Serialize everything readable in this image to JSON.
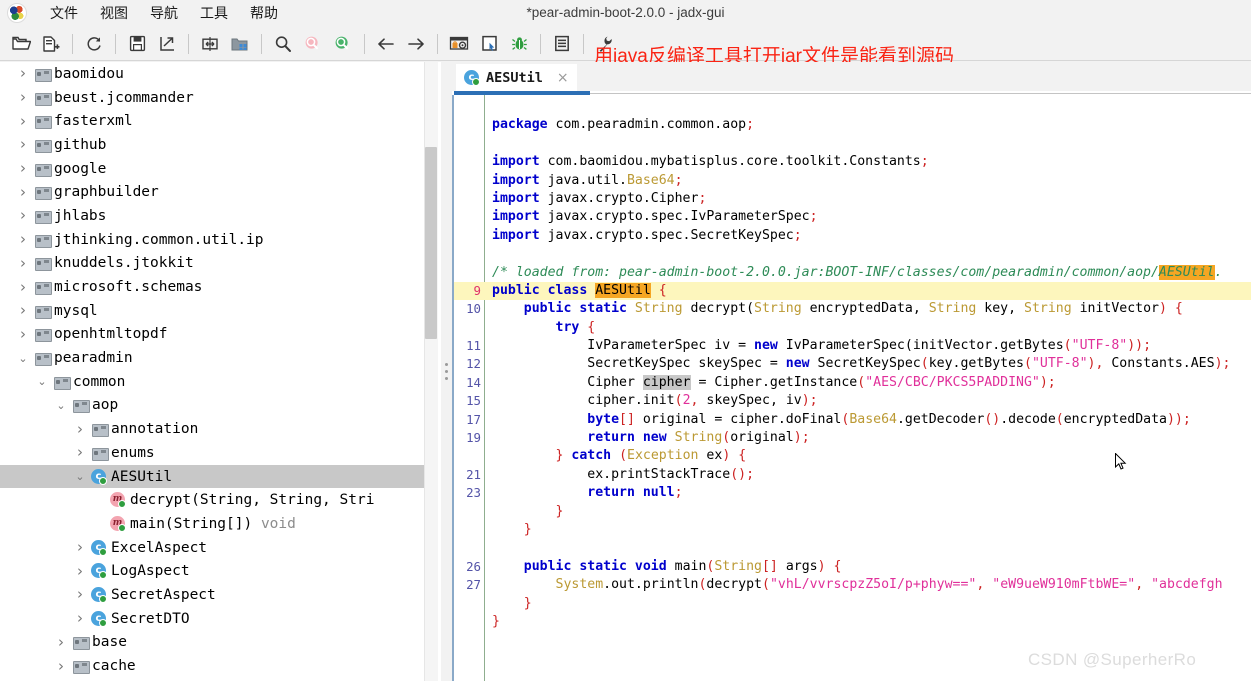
{
  "window": {
    "title": "*pear-admin-boot-2.0.0 - jadx-gui"
  },
  "annotation": {
    "text": "用java反编译工具打开jar文件是能看到源码",
    "color": "#fa2414"
  },
  "watermark": "CSDN @SuperherRo",
  "menubar": {
    "logo": "jadx-logo-icon",
    "items": [
      {
        "label": "文件"
      },
      {
        "label": "视图"
      },
      {
        "label": "导航"
      },
      {
        "label": "工具"
      },
      {
        "label": "帮助"
      }
    ]
  },
  "toolbar": {
    "buttons": [
      {
        "name": "open-file-icon",
        "title": "打开文件"
      },
      {
        "name": "add-files-icon",
        "title": "添加文件"
      },
      {
        "sep": true
      },
      {
        "name": "reload-icon",
        "title": "重新加载"
      },
      {
        "sep": true
      },
      {
        "name": "save-all-icon",
        "title": "保存全部"
      },
      {
        "name": "export-gradle-icon",
        "title": "导出"
      },
      {
        "sep": true
      },
      {
        "name": "sync-icon",
        "title": "同步"
      },
      {
        "name": "flatten-packages-icon",
        "title": "扁平化包"
      },
      {
        "sep": true
      },
      {
        "name": "search-icon",
        "title": "搜索文本"
      },
      {
        "name": "search-class-icon",
        "title": "搜索类"
      },
      {
        "name": "search-comment-icon",
        "title": "搜索注释"
      },
      {
        "sep": true
      },
      {
        "name": "back-arrow-icon",
        "title": "后退"
      },
      {
        "name": "forward-arrow-icon",
        "title": "前进"
      },
      {
        "sep": true
      },
      {
        "name": "deobfuscation-icon",
        "title": "反混淆"
      },
      {
        "name": "quark-icon",
        "title": "Quark 引擎"
      },
      {
        "name": "bug-icon",
        "title": "调试"
      },
      {
        "sep": true
      },
      {
        "name": "log-viewer-icon",
        "title": "日志"
      },
      {
        "sep": true
      },
      {
        "name": "preferences-wrench-icon",
        "title": "设置"
      }
    ]
  },
  "tree": {
    "rows": [
      {
        "indent": 1,
        "twisty": "collapsed",
        "icon": "folder-icon",
        "label": "baomidou"
      },
      {
        "indent": 1,
        "twisty": "collapsed",
        "icon": "folder-icon",
        "label": "beust.jcommander"
      },
      {
        "indent": 1,
        "twisty": "collapsed",
        "icon": "folder-icon",
        "label": "fasterxml"
      },
      {
        "indent": 1,
        "twisty": "collapsed",
        "icon": "folder-icon",
        "label": "github"
      },
      {
        "indent": 1,
        "twisty": "collapsed",
        "icon": "folder-icon",
        "label": "google"
      },
      {
        "indent": 1,
        "twisty": "collapsed",
        "icon": "folder-icon",
        "label": "graphbuilder"
      },
      {
        "indent": 1,
        "twisty": "collapsed",
        "icon": "folder-icon",
        "label": "jhlabs"
      },
      {
        "indent": 1,
        "twisty": "collapsed",
        "icon": "folder-icon",
        "label": "jthinking.common.util.ip"
      },
      {
        "indent": 1,
        "twisty": "collapsed",
        "icon": "folder-icon",
        "label": "knuddels.jtokkit"
      },
      {
        "indent": 1,
        "twisty": "collapsed",
        "icon": "folder-icon",
        "label": "microsoft.schemas"
      },
      {
        "indent": 1,
        "twisty": "collapsed",
        "icon": "folder-icon",
        "label": "mysql"
      },
      {
        "indent": 1,
        "twisty": "collapsed",
        "icon": "folder-icon",
        "label": "openhtmltopdf"
      },
      {
        "indent": 1,
        "twisty": "expanded",
        "icon": "folder-icon",
        "label": "pearadmin"
      },
      {
        "indent": 2,
        "twisty": "expanded",
        "icon": "folder-icon",
        "label": "common"
      },
      {
        "indent": 3,
        "twisty": "expanded",
        "icon": "folder-icon",
        "label": "aop"
      },
      {
        "indent": 4,
        "twisty": "collapsed",
        "icon": "folder-icon",
        "label": "annotation"
      },
      {
        "indent": 4,
        "twisty": "collapsed",
        "icon": "folder-icon",
        "label": "enums"
      },
      {
        "indent": 4,
        "twisty": "expanded",
        "icon": "class-icon",
        "label": "AESUtil",
        "selected": true
      },
      {
        "indent": 5,
        "twisty": "none",
        "icon": "method-icon",
        "label": "decrypt(String, String, Stri"
      },
      {
        "indent": 5,
        "twisty": "none",
        "icon": "method-icon",
        "label": "main(String[])",
        "label_dim": " void"
      },
      {
        "indent": 4,
        "twisty": "collapsed",
        "icon": "class-icon",
        "label": "ExcelAspect"
      },
      {
        "indent": 4,
        "twisty": "collapsed",
        "icon": "class-icon",
        "label": "LogAspect"
      },
      {
        "indent": 4,
        "twisty": "collapsed",
        "icon": "class-icon",
        "label": "SecretAspect"
      },
      {
        "indent": 4,
        "twisty": "collapsed",
        "icon": "class-icon",
        "label": "SecretDTO"
      },
      {
        "indent": 3,
        "twisty": "collapsed",
        "icon": "folder-icon",
        "label": "base"
      },
      {
        "indent": 3,
        "twisty": "collapsed",
        "icon": "folder-icon",
        "label": "cache"
      }
    ]
  },
  "editor": {
    "tab": {
      "label": "AESUtil",
      "icon": "class-icon",
      "close": "×"
    },
    "code": [
      {
        "num": "",
        "tokens": []
      },
      {
        "num": "",
        "tokens": [
          {
            "t": "kw",
            "v": "package"
          },
          {
            "t": "plain",
            "v": " com.pearadmin.common.aop"
          },
          {
            "t": "pun",
            "v": ";"
          }
        ]
      },
      {
        "num": "",
        "tokens": []
      },
      {
        "num": "",
        "tokens": [
          {
            "t": "kw",
            "v": "import"
          },
          {
            "t": "plain",
            "v": " com.baomidou.mybatisplus.core.toolkit.Constants"
          },
          {
            "t": "pun",
            "v": ";"
          }
        ]
      },
      {
        "num": "",
        "tokens": [
          {
            "t": "kw",
            "v": "import"
          },
          {
            "t": "plain",
            "v": " java.util."
          },
          {
            "t": "typ",
            "v": "Base64"
          },
          {
            "t": "pun",
            "v": ";"
          }
        ]
      },
      {
        "num": "",
        "tokens": [
          {
            "t": "kw",
            "v": "import"
          },
          {
            "t": "plain",
            "v": " javax.crypto.Cipher"
          },
          {
            "t": "pun",
            "v": ";"
          }
        ]
      },
      {
        "num": "",
        "tokens": [
          {
            "t": "kw",
            "v": "import"
          },
          {
            "t": "plain",
            "v": " javax.crypto.spec.IvParameterSpec"
          },
          {
            "t": "pun",
            "v": ";"
          }
        ]
      },
      {
        "num": "",
        "tokens": [
          {
            "t": "kw",
            "v": "import"
          },
          {
            "t": "plain",
            "v": " javax.crypto.spec.SecretKeySpec"
          },
          {
            "t": "pun",
            "v": ";"
          }
        ]
      },
      {
        "num": "",
        "tokens": []
      },
      {
        "num": "",
        "tokens": [
          {
            "t": "cmt",
            "v": "/* loaded from: pear-admin-boot-2.0.0.jar:BOOT-INF/classes/com/pearadmin/common/aop/"
          },
          {
            "t": "cmt mark",
            "v": "AESUtil"
          },
          {
            "t": "cmt",
            "v": "."
          }
        ]
      },
      {
        "num": "9",
        "hl": true,
        "cur": true,
        "tokens": [
          {
            "t": "kw",
            "v": "public class "
          },
          {
            "t": "plain mark",
            "v": "AESUtil"
          },
          {
            "t": "pun",
            "v": " {"
          }
        ]
      },
      {
        "num": "10",
        "tokens": [
          {
            "t": "plain",
            "v": "    "
          },
          {
            "t": "kw",
            "v": "public static "
          },
          {
            "t": "typ",
            "v": "String"
          },
          {
            "t": "plain",
            "v": " decrypt("
          },
          {
            "t": "typ",
            "v": "String"
          },
          {
            "t": "plain",
            "v": " encryptedData, "
          },
          {
            "t": "typ",
            "v": "String"
          },
          {
            "t": "plain",
            "v": " key, "
          },
          {
            "t": "typ",
            "v": "String"
          },
          {
            "t": "plain",
            "v": " initVector"
          },
          {
            "t": "pun",
            "v": ") {"
          }
        ]
      },
      {
        "num": "",
        "tokens": [
          {
            "t": "plain",
            "v": "        "
          },
          {
            "t": "kw",
            "v": "try "
          },
          {
            "t": "pun",
            "v": "{"
          }
        ]
      },
      {
        "num": "11",
        "tokens": [
          {
            "t": "plain",
            "v": "            IvParameterSpec iv = "
          },
          {
            "t": "kw",
            "v": "new"
          },
          {
            "t": "plain",
            "v": " IvParameterSpec(initVector.getBytes"
          },
          {
            "t": "pun",
            "v": "("
          },
          {
            "t": "str",
            "v": "\"UTF-8\""
          },
          {
            "t": "pun",
            "v": "));"
          }
        ]
      },
      {
        "num": "12",
        "tokens": [
          {
            "t": "plain",
            "v": "            SecretKeySpec skeySpec = "
          },
          {
            "t": "kw",
            "v": "new"
          },
          {
            "t": "plain",
            "v": " SecretKeySpec"
          },
          {
            "t": "pun",
            "v": "("
          },
          {
            "t": "plain",
            "v": "key.getBytes"
          },
          {
            "t": "pun",
            "v": "("
          },
          {
            "t": "str",
            "v": "\"UTF-8\""
          },
          {
            "t": "pun",
            "v": "), "
          },
          {
            "t": "plain",
            "v": "Constants.AES"
          },
          {
            "t": "pun",
            "v": ");"
          }
        ]
      },
      {
        "num": "14",
        "tokens": [
          {
            "t": "plain",
            "v": "            Cipher "
          },
          {
            "t": "plain hovmark",
            "v": "cipher"
          },
          {
            "t": "plain",
            "v": " = Cipher.getInstance"
          },
          {
            "t": "pun",
            "v": "("
          },
          {
            "t": "str",
            "v": "\"AES/CBC/PKCS5PADDING\""
          },
          {
            "t": "pun",
            "v": ");"
          }
        ]
      },
      {
        "num": "15",
        "tokens": [
          {
            "t": "plain",
            "v": "            cipher.init"
          },
          {
            "t": "pun",
            "v": "("
          },
          {
            "t": "num",
            "v": "2"
          },
          {
            "t": "pun",
            "v": ", "
          },
          {
            "t": "plain",
            "v": "skeySpec, iv"
          },
          {
            "t": "pun",
            "v": ");"
          }
        ]
      },
      {
        "num": "17",
        "tokens": [
          {
            "t": "plain",
            "v": "            "
          },
          {
            "t": "kw",
            "v": "byte"
          },
          {
            "t": "pun",
            "v": "[]"
          },
          {
            "t": "plain",
            "v": " original = cipher.doFinal"
          },
          {
            "t": "pun",
            "v": "("
          },
          {
            "t": "typ",
            "v": "Base64"
          },
          {
            "t": "plain",
            "v": ".getDecoder"
          },
          {
            "t": "pun",
            "v": "()"
          },
          {
            "t": "plain",
            "v": ".decode"
          },
          {
            "t": "pun",
            "v": "("
          },
          {
            "t": "plain",
            "v": "encryptedData"
          },
          {
            "t": "pun",
            "v": "));"
          }
        ]
      },
      {
        "num": "19",
        "tokens": [
          {
            "t": "plain",
            "v": "            "
          },
          {
            "t": "kw",
            "v": "return new "
          },
          {
            "t": "typ",
            "v": "String"
          },
          {
            "t": "pun",
            "v": "("
          },
          {
            "t": "plain",
            "v": "original"
          },
          {
            "t": "pun",
            "v": ");"
          }
        ]
      },
      {
        "num": "",
        "tokens": [
          {
            "t": "plain",
            "v": "        "
          },
          {
            "t": "pun",
            "v": "} "
          },
          {
            "t": "kw",
            "v": "catch "
          },
          {
            "t": "pun",
            "v": "("
          },
          {
            "t": "typ",
            "v": "Exception"
          },
          {
            "t": "plain",
            "v": " ex"
          },
          {
            "t": "pun",
            "v": ") {"
          }
        ]
      },
      {
        "num": "21",
        "tokens": [
          {
            "t": "plain",
            "v": "            ex.printStackTrace"
          },
          {
            "t": "pun",
            "v": "();"
          }
        ]
      },
      {
        "num": "23",
        "tokens": [
          {
            "t": "plain",
            "v": "            "
          },
          {
            "t": "kw",
            "v": "return null"
          },
          {
            "t": "pun",
            "v": ";"
          }
        ]
      },
      {
        "num": "",
        "tokens": [
          {
            "t": "plain",
            "v": "        "
          },
          {
            "t": "pun",
            "v": "}"
          }
        ]
      },
      {
        "num": "",
        "tokens": [
          {
            "t": "plain",
            "v": "    "
          },
          {
            "t": "pun",
            "v": "}"
          }
        ]
      },
      {
        "num": "",
        "tokens": []
      },
      {
        "num": "26",
        "tokens": [
          {
            "t": "plain",
            "v": "    "
          },
          {
            "t": "kw",
            "v": "public static void "
          },
          {
            "t": "plain",
            "v": "main"
          },
          {
            "t": "pun",
            "v": "("
          },
          {
            "t": "typ",
            "v": "String"
          },
          {
            "t": "pun",
            "v": "[]"
          },
          {
            "t": "plain",
            "v": " args"
          },
          {
            "t": "pun",
            "v": ") {"
          }
        ]
      },
      {
        "num": "27",
        "tokens": [
          {
            "t": "plain",
            "v": "        "
          },
          {
            "t": "typ",
            "v": "System"
          },
          {
            "t": "plain",
            "v": ".out.println"
          },
          {
            "t": "pun",
            "v": "("
          },
          {
            "t": "plain",
            "v": "decrypt"
          },
          {
            "t": "pun",
            "v": "("
          },
          {
            "t": "str",
            "v": "\"vhL/vvrscpzZ5oI/p+phyw==\""
          },
          {
            "t": "pun",
            "v": ", "
          },
          {
            "t": "str",
            "v": "\"eW9ueW910mFtbWE=\""
          },
          {
            "t": "pun",
            "v": ", "
          },
          {
            "t": "str",
            "v": "\"abcdefgh"
          }
        ]
      },
      {
        "num": "",
        "tokens": [
          {
            "t": "plain",
            "v": "    "
          },
          {
            "t": "pun",
            "v": "}"
          }
        ]
      },
      {
        "num": "",
        "tokens": [
          {
            "t": "pun",
            "v": "}"
          }
        ]
      }
    ]
  }
}
